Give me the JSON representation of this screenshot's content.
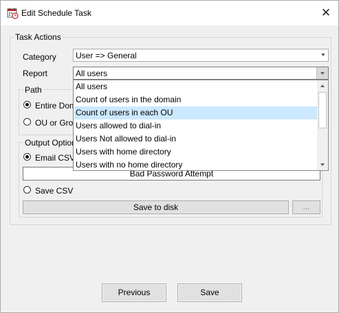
{
  "window": {
    "title": "Edit Schedule Task",
    "icon": "calendar-clock-icon",
    "close_label": "✕"
  },
  "task_actions": {
    "group_label": "Task Actions",
    "category_label": "Category",
    "category_value": "User => General",
    "report_label": "Report",
    "report_value": "All users",
    "report_options": [
      "All users",
      "Count of users in the domain",
      "Count of users in each OU",
      "Users allowed to dial-in",
      "Users Not allowed to dial-in",
      "Users with home directory",
      "Users with no home directory"
    ],
    "highlighted_option_index": 2
  },
  "path": {
    "group_label": "Path",
    "entire_domain_label": "Entire Doma",
    "ou_or_group_label": "OU or Grou",
    "selected": "entire_domain"
  },
  "output_options": {
    "group_label": "Output Option",
    "email_csv_label": "Email CSV",
    "email_target_value": "Bad Password Attempt",
    "save_csv_label": "Save CSV",
    "save_to_disk_label": "Save to disk",
    "browse_label": "...",
    "selected": "email_csv"
  },
  "footer": {
    "previous_label": "Previous",
    "save_label": "Save"
  }
}
